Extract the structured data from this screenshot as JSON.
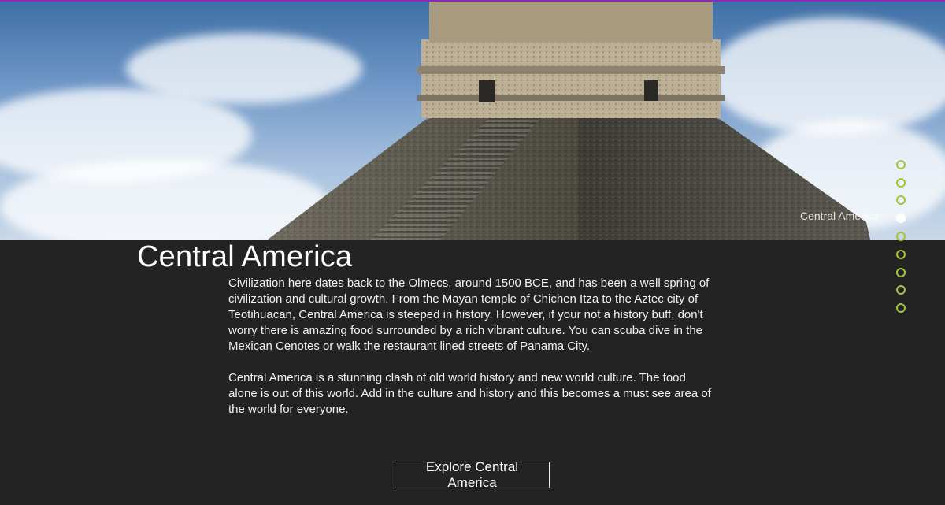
{
  "hero": {
    "image_alt": "Chichen Itza pyramid under cloudy blue sky",
    "accent_color": "#8a2bb5"
  },
  "section": {
    "title": "Central America",
    "paragraphs": [
      "Civilization here dates back to the Olmecs, around 1500 BCE, and has been a well spring of civilization and cultural growth. From the Mayan temple of Chichen Itza to the Aztec city of Teotihuacan, Central America is steeped in history. However, if your not a history buff, don't worry there is amazing food surrounded by a rich vibrant culture. You can scuba dive in the Mexican Cenotes or walk the restaurant lined streets of Panama City.",
      "Central America is a stunning clash of old world history and new world culture. The food alone is out of this world. Add in the culture and history and this becomes a must see area of the world for everyone."
    ],
    "cta_label": "Explore Central America"
  },
  "nav_dots": {
    "active_label": "Central America",
    "dot_color": "#a5c43a",
    "active_index": 3,
    "count": 9
  }
}
